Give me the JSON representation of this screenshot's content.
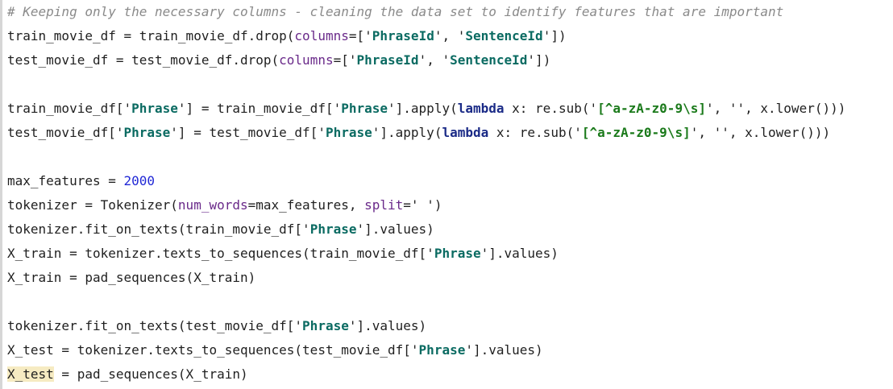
{
  "code_lines": [
    [
      {
        "t": "# Keeping only the necessary columns - cleaning the data set to identify features that are important",
        "c": "cm"
      }
    ],
    [
      {
        "t": "train_movie_df = train_movie_df.drop(",
        "c": ""
      },
      {
        "t": "columns",
        "c": "kwarg"
      },
      {
        "t": "=['",
        "c": ""
      },
      {
        "t": "PhraseId",
        "c": "str"
      },
      {
        "t": "', '",
        "c": ""
      },
      {
        "t": "SentenceId",
        "c": "str"
      },
      {
        "t": "'])",
        "c": ""
      }
    ],
    [
      {
        "t": "test_movie_df = test_movie_df.drop(",
        "c": ""
      },
      {
        "t": "columns",
        "c": "kwarg"
      },
      {
        "t": "=['",
        "c": ""
      },
      {
        "t": "PhraseId",
        "c": "str"
      },
      {
        "t": "', '",
        "c": ""
      },
      {
        "t": "SentenceId",
        "c": "str"
      },
      {
        "t": "'])",
        "c": ""
      }
    ],
    [],
    [
      {
        "t": "train_movie_df['",
        "c": ""
      },
      {
        "t": "Phrase",
        "c": "str"
      },
      {
        "t": "'] = train_movie_df['",
        "c": ""
      },
      {
        "t": "Phrase",
        "c": "str"
      },
      {
        "t": "'].apply(",
        "c": ""
      },
      {
        "t": "lambda",
        "c": "kw"
      },
      {
        "t": " x: re.sub('",
        "c": ""
      },
      {
        "t": "[^a-zA-z0-9\\s]",
        "c": "rx"
      },
      {
        "t": "', '', x.lower()))",
        "c": ""
      }
    ],
    [
      {
        "t": "test_movie_df['",
        "c": ""
      },
      {
        "t": "Phrase",
        "c": "str"
      },
      {
        "t": "'] = test_movie_df['",
        "c": ""
      },
      {
        "t": "Phrase",
        "c": "str"
      },
      {
        "t": "'].apply(",
        "c": ""
      },
      {
        "t": "lambda",
        "c": "kw"
      },
      {
        "t": " x: re.sub('",
        "c": ""
      },
      {
        "t": "[^a-zA-z0-9\\s]",
        "c": "rx"
      },
      {
        "t": "', '', x.lower()))",
        "c": ""
      }
    ],
    [],
    [
      {
        "t": "max_features = ",
        "c": ""
      },
      {
        "t": "2000",
        "c": "num"
      }
    ],
    [
      {
        "t": "tokenizer = Tokenizer(",
        "c": ""
      },
      {
        "t": "num_words",
        "c": "kwarg"
      },
      {
        "t": "=max_features, ",
        "c": ""
      },
      {
        "t": "split",
        "c": "kwarg"
      },
      {
        "t": "=' ')",
        "c": ""
      }
    ],
    [
      {
        "t": "tokenizer.fit_on_texts(train_movie_df['",
        "c": ""
      },
      {
        "t": "Phrase",
        "c": "str"
      },
      {
        "t": "'].values)",
        "c": ""
      }
    ],
    [
      {
        "t": "X_train = tokenizer.texts_to_sequences(train_movie_df['",
        "c": ""
      },
      {
        "t": "Phrase",
        "c": "str"
      },
      {
        "t": "'].values)",
        "c": ""
      }
    ],
    [
      {
        "t": "X_train = pad_sequences(X_train)",
        "c": ""
      }
    ],
    [],
    [
      {
        "t": "tokenizer.fit_on_texts(test_movie_df['",
        "c": ""
      },
      {
        "t": "Phrase",
        "c": "str"
      },
      {
        "t": "'].values)",
        "c": ""
      }
    ],
    [
      {
        "t": "X_test = tokenizer.texts_to_sequences(test_movie_df['",
        "c": ""
      },
      {
        "t": "Phrase",
        "c": "str"
      },
      {
        "t": "'].values)",
        "c": ""
      }
    ],
    [
      {
        "t": "X_test",
        "c": "hl"
      },
      {
        "t": " = pad_sequences(X_train)",
        "c": ""
      }
    ]
  ]
}
